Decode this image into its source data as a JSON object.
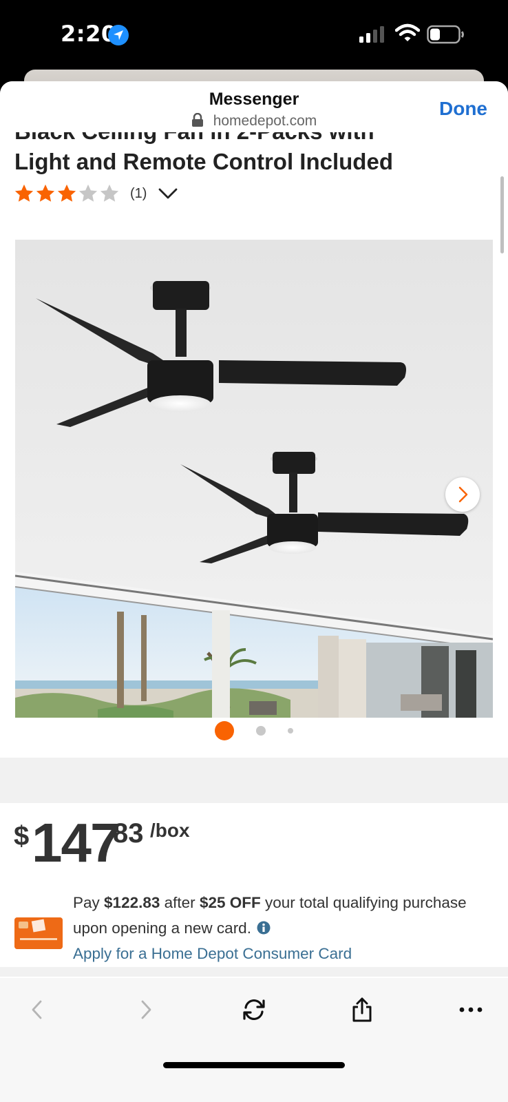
{
  "status_bar": {
    "time": "2:20"
  },
  "sheet": {
    "title": "Messenger",
    "url": "homedepot.com",
    "done_label": "Done"
  },
  "product": {
    "title_partial": "Black Ceiling Fan in 2-Packs with",
    "title_line2": "Light and Remote Control Included",
    "rating_stars": 3,
    "rating_max": 5,
    "review_count": "(1)"
  },
  "gallery": {
    "image_count": 3,
    "active_index": 0
  },
  "price": {
    "currency": "$",
    "dollars": "147",
    "cents": "83",
    "unit": "/box"
  },
  "promo": {
    "text_1": "Pay",
    "amount_after": "$122.83",
    "text_2": "after",
    "discount": "$25 OFF",
    "text_3": "your total qualifying purchase upon opening a new card.",
    "link": "Apply for a Home Depot Consumer Card"
  },
  "toolbar": {
    "items": [
      "back-icon",
      "forward-icon",
      "reload-icon",
      "share-icon",
      "more-icon"
    ]
  },
  "colors": {
    "accent": "#f96302",
    "link": "#3a6f93",
    "done": "#1f6fd1"
  }
}
